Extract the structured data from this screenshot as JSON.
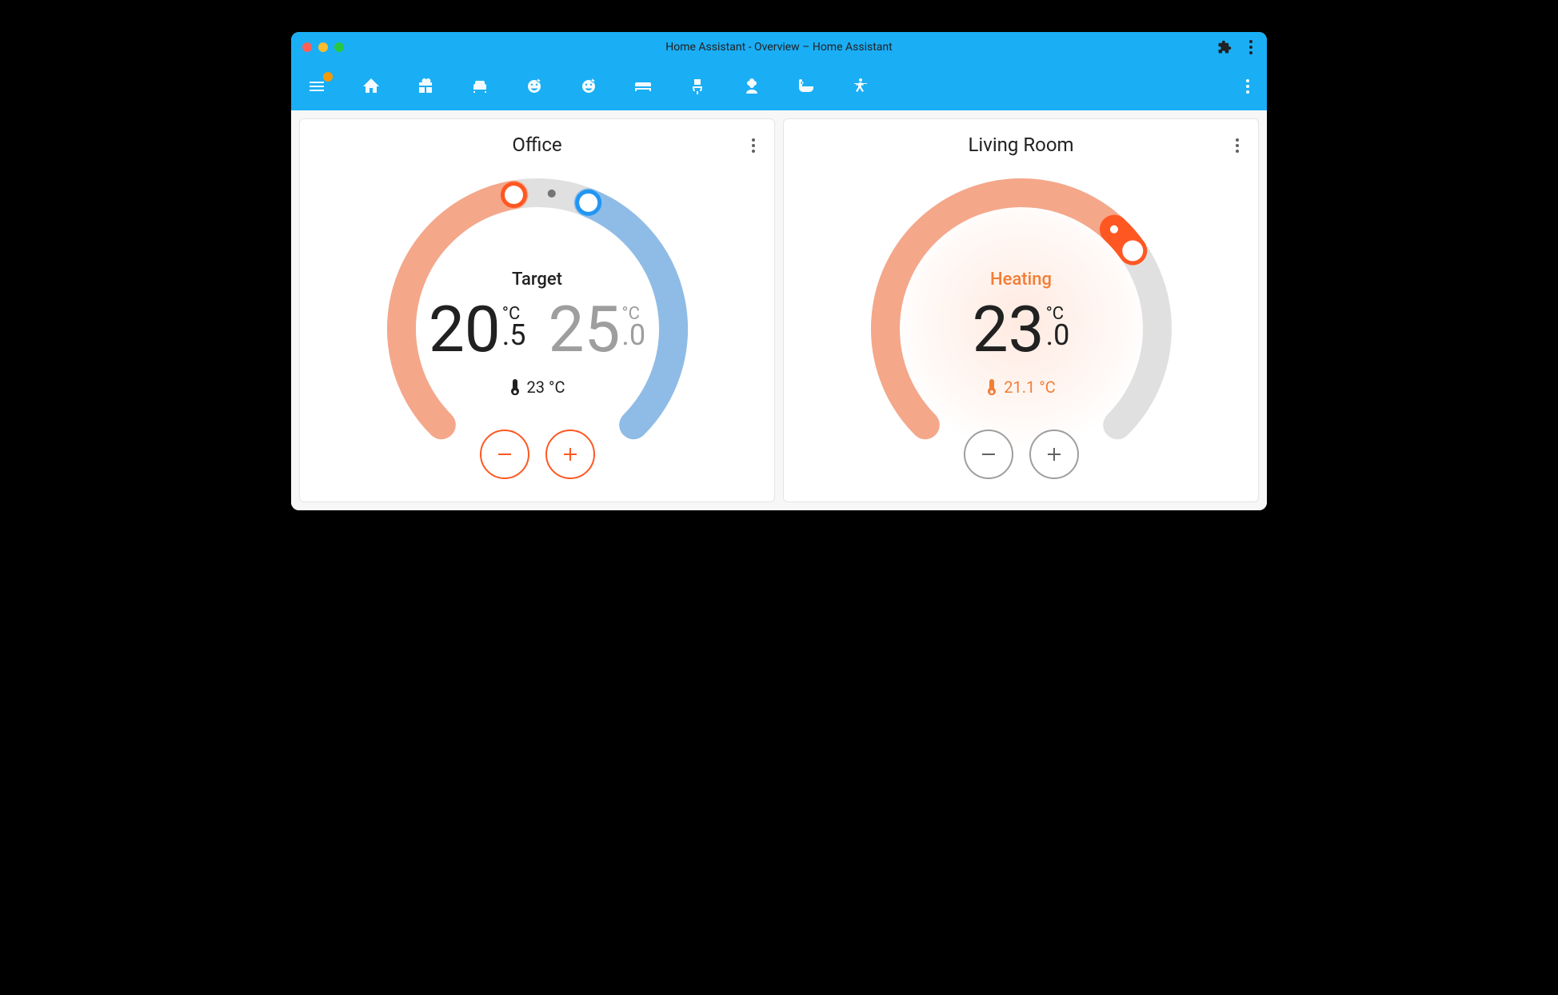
{
  "window": {
    "title": "Home Assistant - Overview – Home Assistant"
  },
  "toolbar": {
    "icons": [
      "menu",
      "home",
      "gift",
      "couch",
      "face-1",
      "face-2",
      "bed",
      "chair",
      "flower",
      "bathtub",
      "crosswalk"
    ]
  },
  "cards": [
    {
      "title": "Office",
      "mode_label": "Target",
      "mode_color": "default",
      "style": "dual",
      "low": {
        "int": "20",
        "dec": ".5",
        "unit": "°C"
      },
      "high": {
        "int": "25",
        "dec": ".0",
        "unit": "°C"
      },
      "current": "23 °C",
      "current_color": "default",
      "button_style": "orange",
      "arc": {
        "heat_start": 225,
        "heat_end": 100,
        "cool_start": 68,
        "cool_end": -45,
        "track_color": "#e0e0e0",
        "heat_color": "#f5a78a",
        "cool_color": "#8fbce6",
        "low_handle_angle": 100,
        "high_handle_angle": 68,
        "mid_dot_angle": 84,
        "glow": false
      }
    },
    {
      "title": "Living Room",
      "mode_label": "Heating",
      "mode_color": "orange",
      "style": "single",
      "single": {
        "int": "23",
        "dec": ".0",
        "unit": "°C"
      },
      "current": "21.1 °C",
      "current_color": "orange",
      "button_style": "grey",
      "arc": {
        "heat_start": 225,
        "heat_end": 35,
        "track_color": "#e0e0e0",
        "heat_color": "#f5a78a",
        "handle_angle": 35,
        "glow": true
      }
    }
  ]
}
